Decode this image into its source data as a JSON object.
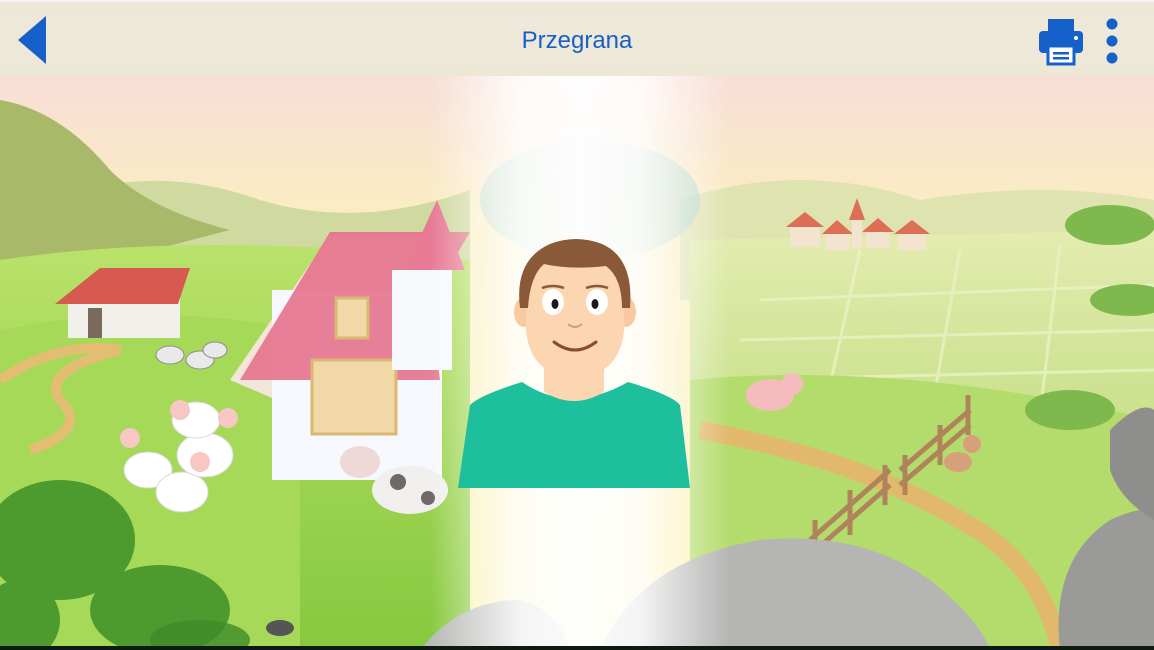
{
  "header": {
    "title": "Przegrana",
    "back_icon": "back-arrow-icon",
    "print_icon": "printer-icon",
    "menu_icon": "more-vertical-icon"
  },
  "colors": {
    "accent": "#1560c9",
    "shirt": "#1dbf9c",
    "skin": "#fcd6b0",
    "hair": "#8a5a38"
  },
  "scene": {
    "character": "boy-avatar",
    "background": "farm-landscape"
  }
}
